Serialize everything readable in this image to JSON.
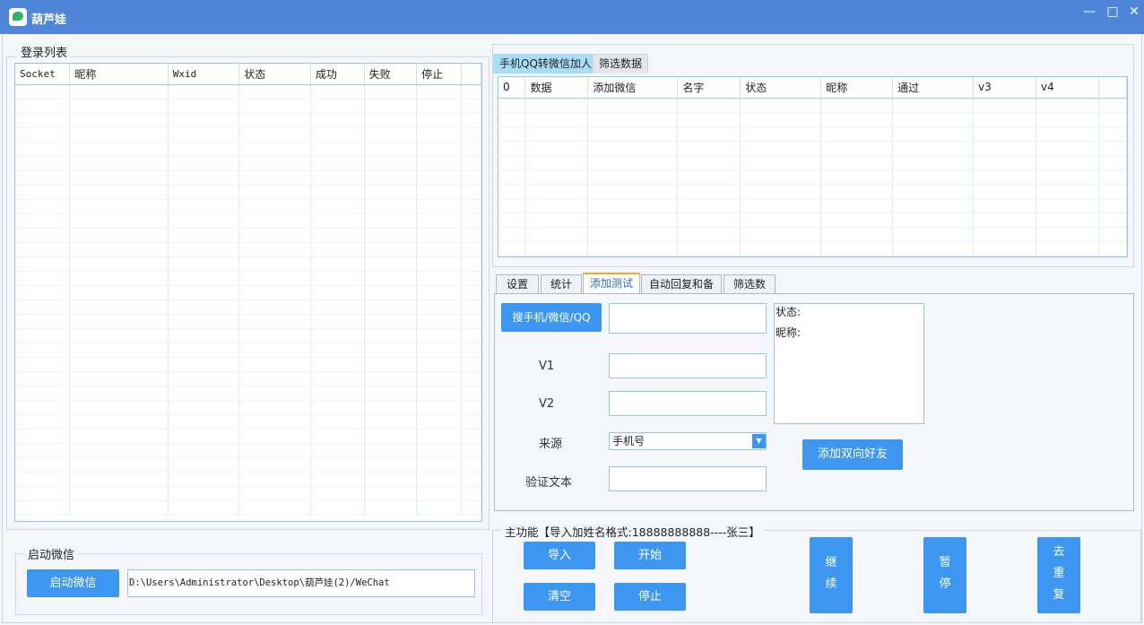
{
  "window": {
    "title": "葫芦娃"
  },
  "login_list": {
    "label": "登录列表",
    "columns": [
      "Socket",
      "昵称",
      "Wxid",
      "状态",
      "成功",
      "失败",
      "停止"
    ]
  },
  "start_wechat": {
    "label": "启动微信",
    "button": "启动微信",
    "path": "D:\\Users\\Administrator\\Desktop\\葫芦娃(2)/WeChat"
  },
  "top_tabs": [
    "手机QQ转微信加人",
    "筛选数据"
  ],
  "data_grid": {
    "columns": [
      "0",
      "数据",
      "添加微信",
      "名字",
      "状态",
      "昵称",
      "通过",
      "v3",
      "v4"
    ]
  },
  "mid_tabs": [
    "设置",
    "统计",
    "添加测试",
    "自动回复和备注",
    "筛选数据"
  ],
  "test_panel": {
    "search_button": "搜手机/微信/QQ",
    "v1_label": "V1",
    "v2_label": "V2",
    "source_label": "来源",
    "source_value": "手机号",
    "verify_label": "验证文本",
    "status_label": "状态:",
    "nickname_label": "昵称:",
    "add_button": "添加双向好友"
  },
  "main_func": {
    "label": "主功能【导入加姓名格式:18888888888----张三】",
    "import": "导入",
    "start": "开始",
    "clear": "清空",
    "stop": "停止",
    "continue_chars": [
      "继",
      "续"
    ],
    "pause_chars": [
      "暂",
      "停"
    ],
    "dedupe_chars": [
      "去",
      "重",
      "复"
    ]
  }
}
